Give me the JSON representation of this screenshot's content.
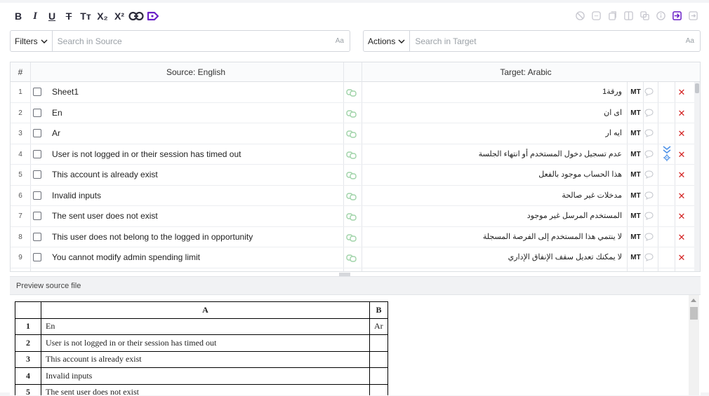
{
  "toolbar": {
    "format_buttons": [
      {
        "name": "bold-button",
        "label": "B"
      },
      {
        "name": "italic-button",
        "label": "I"
      },
      {
        "name": "underline-button",
        "label": "U"
      },
      {
        "name": "strikethrough-button",
        "label": "T"
      },
      {
        "name": "text-size-button",
        "label": "Tт"
      },
      {
        "name": "subscript-button",
        "label": "X₂"
      },
      {
        "name": "superscript-button",
        "label": "X²"
      }
    ],
    "right_icons": [
      "block-icon",
      "tag-icon",
      "copy-source-icon",
      "split-icon",
      "merge-icon",
      "info-icon",
      "insert-target-icon",
      "exit-icon"
    ]
  },
  "source_search": {
    "filter_label": "Filters",
    "placeholder": "Search in Source",
    "case_label": "Aa"
  },
  "target_search": {
    "action_label": "Actions",
    "placeholder": "Search in Target",
    "case_label": "Aa"
  },
  "grid": {
    "headers": {
      "num": "#",
      "source": "Source: English",
      "target": "Target: Arabic"
    },
    "rows": [
      {
        "num": "1",
        "source": "Sheet1",
        "target": "ورقة1",
        "mt": "MT"
      },
      {
        "num": "2",
        "source": "En",
        "target": "اى ان",
        "mt": "MT"
      },
      {
        "num": "3",
        "source": "Ar",
        "target": "ايه ار",
        "mt": "MT"
      },
      {
        "num": "4",
        "source": "User is not logged in or their session has timed out",
        "target": "عدم تسجيل دخول المستخدم أو انتهاء الجلسة",
        "mt": "MT"
      },
      {
        "num": "5",
        "source": "This account is already exist",
        "target": "هذا الحساب موجود بالفعل",
        "mt": "MT"
      },
      {
        "num": "6",
        "source": "Invalid inputs",
        "target": "مدخلات غير صالحة",
        "mt": "MT"
      },
      {
        "num": "7",
        "source": "The sent user does not exist",
        "target": "المستخدم المرسل غير موجود",
        "mt": "MT"
      },
      {
        "num": "8",
        "source": "This user does not belong to the logged in opportunity",
        "target": "لا ينتمي هذا المستخدم إلى الفرصة المسجلة",
        "mt": "MT"
      },
      {
        "num": "9",
        "source": "You cannot modify admin spending limit",
        "target": "لا يمكنك تعديل سقف الإنفاق الإداري",
        "mt": "MT"
      }
    ]
  },
  "preview": {
    "title": "Preview source file",
    "columns": [
      "A",
      "B"
    ],
    "rows": [
      {
        "n": "1",
        "a": "En",
        "b": "Ar"
      },
      {
        "n": "2",
        "a": "User is not logged in or their session has timed out",
        "b": ""
      },
      {
        "n": "3",
        "a": "This account is already exist",
        "b": ""
      },
      {
        "n": "4",
        "a": "Invalid inputs",
        "b": ""
      },
      {
        "n": "5",
        "a": "The sent user does not exist",
        "b": ""
      }
    ]
  }
}
